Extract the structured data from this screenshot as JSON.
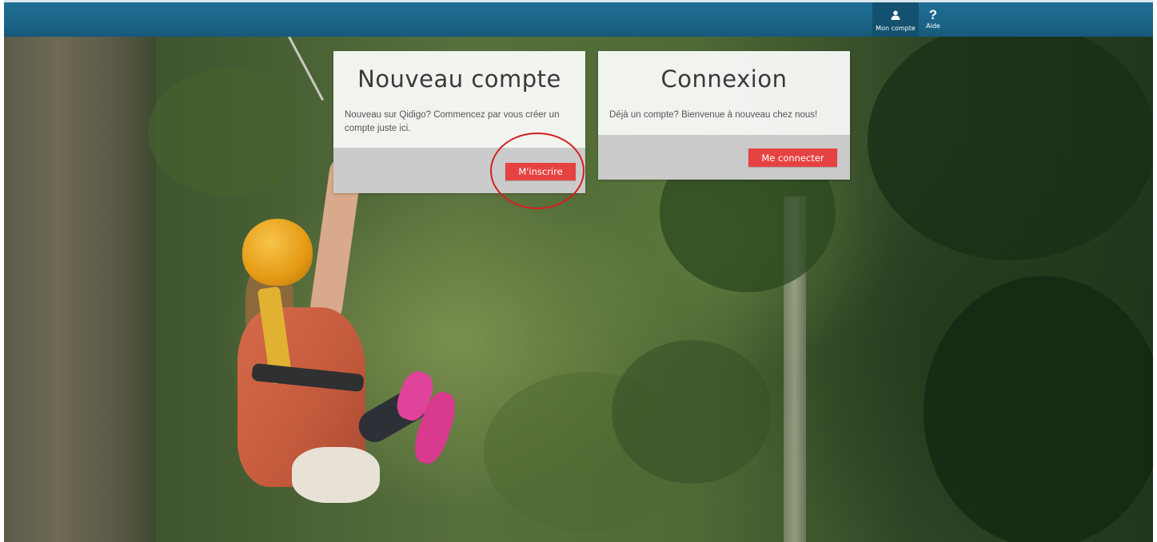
{
  "topbar": {
    "account": {
      "label": "Mon compte",
      "icon": "user-icon"
    },
    "help": {
      "label": "Aide",
      "glyph": "?",
      "icon": "question-icon"
    },
    "color": "#1a6284"
  },
  "cards": {
    "new_account": {
      "title": "Nouveau compte",
      "text": "Nouveau sur Qidigo? Commencez par vous créer un compte juste ici.",
      "button": "M'inscrire"
    },
    "login": {
      "title": "Connexion",
      "text": "Déjà un compte? Bienvenue à nouveau chez nous!",
      "button": "Me connecter"
    }
  },
  "colors": {
    "accent_button": "#e74242",
    "annotation_circle": "#d42020"
  }
}
